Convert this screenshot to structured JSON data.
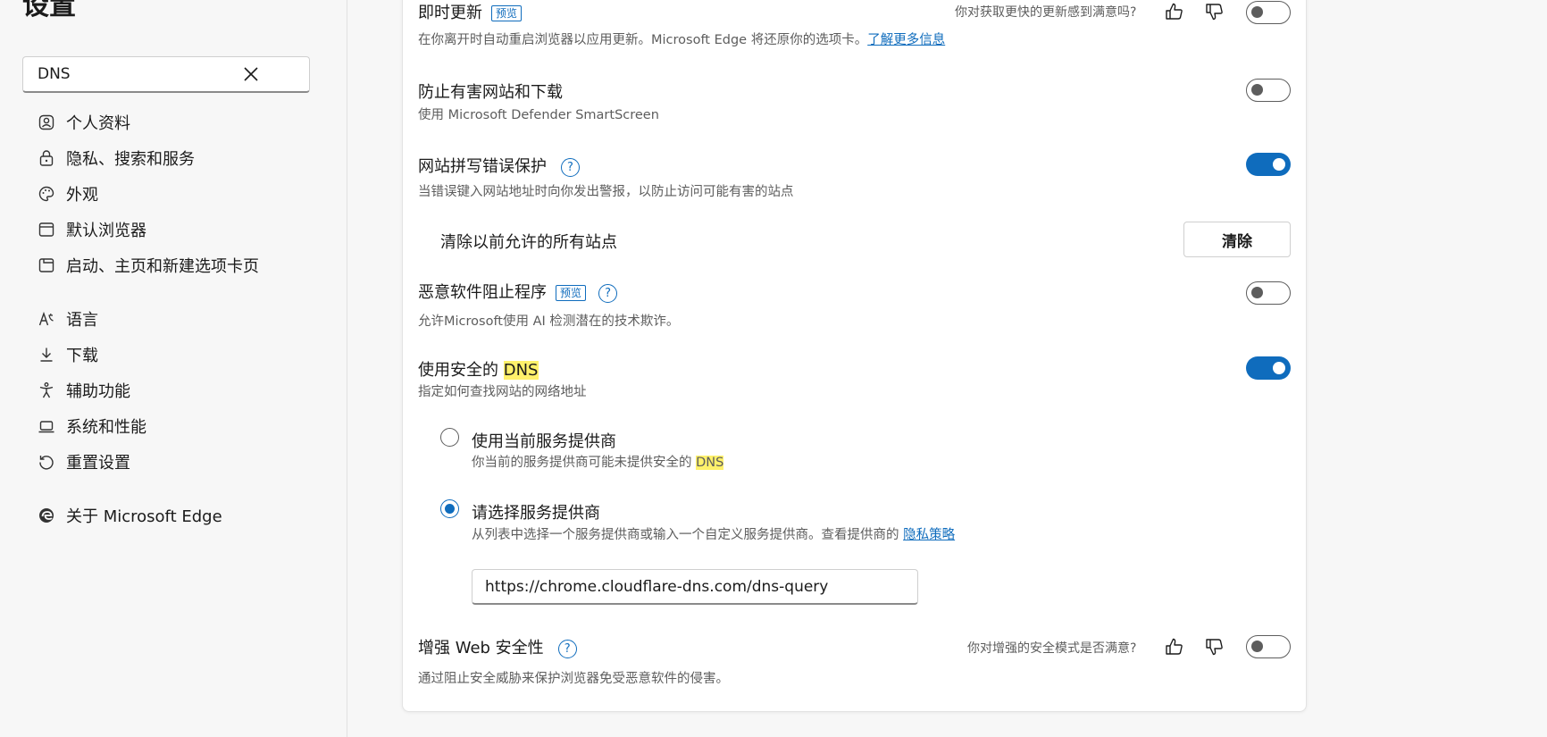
{
  "app": {
    "title": "设置"
  },
  "search": {
    "value": "DNS"
  },
  "sidebar": {
    "items": [
      {
        "label": "个人资料",
        "icon": "profile-icon"
      },
      {
        "label": "隐私、搜索和服务",
        "icon": "lock-icon"
      },
      {
        "label": "外观",
        "icon": "palette-icon"
      },
      {
        "label": "默认浏览器",
        "icon": "browser-icon"
      },
      {
        "label": "启动、主页和新建选项卡页",
        "icon": "home-tab-icon"
      },
      {
        "label": "语言",
        "icon": "language-icon"
      },
      {
        "label": "下载",
        "icon": "download-icon"
      },
      {
        "label": "辅助功能",
        "icon": "accessibility-icon"
      },
      {
        "label": "系统和性能",
        "icon": "laptop-icon"
      },
      {
        "label": "重置设置",
        "icon": "reset-icon"
      },
      {
        "label": "关于 Microsoft Edge",
        "icon": "edge-logo-icon"
      }
    ]
  },
  "settings": {
    "instant_update": {
      "title": "即时更新",
      "badge": "预览",
      "desc": "在你离开时自动重启浏览器以应用更新。Microsoft Edge 将还原你的选项卡。",
      "link": "了解更多信息",
      "feedback": "你对获取更快的更新感到满意吗?",
      "enabled": false
    },
    "smartscreen": {
      "title": "防止有害网站和下载",
      "desc": "使用 Microsoft Defender SmartScreen",
      "enabled": false
    },
    "typo_protection": {
      "title": "网站拼写错误保护",
      "desc": "当错误键入网站地址时向你发出警报，以防止访问可能有害的站点",
      "enabled": true,
      "clear_label": "清除以前允许的所有站点",
      "clear_button": "清除"
    },
    "malware_blocker": {
      "title": "恶意软件阻止程序",
      "badge": "预览",
      "desc": "允许Microsoft使用 AI 检测潜在的技术欺诈。",
      "enabled": false
    },
    "secure_dns": {
      "title_prefix": "使用安全的 ",
      "title_highlight": "DNS",
      "desc": "指定如何查找网站的网络地址",
      "enabled": true,
      "option_current": {
        "title": "使用当前服务提供商",
        "desc_prefix": "你当前的服务提供商可能未提供安全的 ",
        "desc_highlight": "DNS"
      },
      "option_custom": {
        "title": "请选择服务提供商",
        "desc": "从列表中选择一个服务提供商或输入一个自定义服务提供商。查看提供商的 ",
        "link": "隐私策略",
        "url_value": "https://chrome.cloudflare-dns.com/dns-query"
      },
      "selected": "custom"
    },
    "enhanced_security": {
      "title": "增强 Web 安全性",
      "desc": "通过阻止安全威胁来保护浏览器免受恶意软件的侵害。",
      "feedback": "你对增强的安全模式是否满意?",
      "enabled": false
    }
  },
  "colors": {
    "accent": "#0f6cbd",
    "highlight": "#fff16b"
  }
}
